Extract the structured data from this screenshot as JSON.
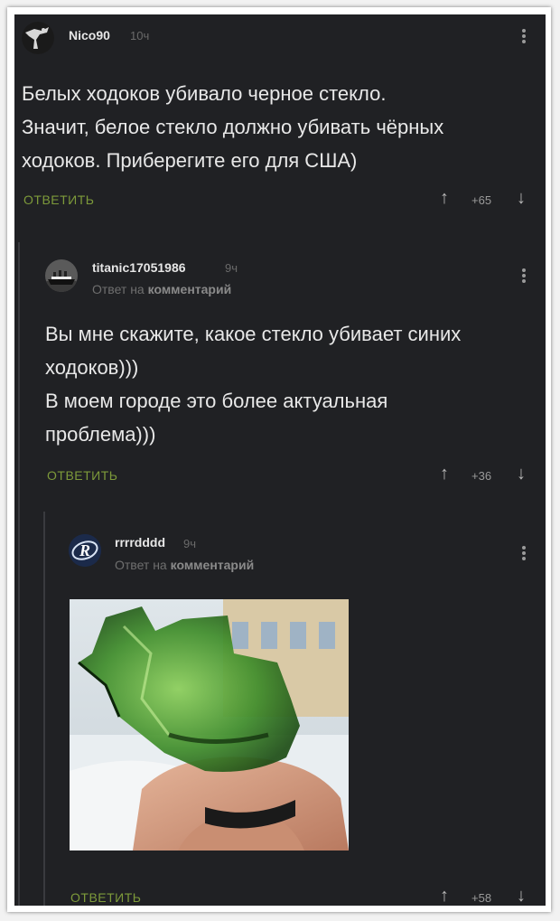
{
  "comments": [
    {
      "username": "Nico90",
      "time": "10ч",
      "lines": [
        "Белых ходоков убивало черное стекло.",
        "Значит, белое стекло должно убивать чёрных",
        "ходоков. Приберегите его для США)"
      ],
      "reply_label": "ответить",
      "score": "+65",
      "avatar_icon": "tree-silhouette-icon"
    },
    {
      "username": "titanic17051986",
      "time": "9ч",
      "reply_to_prefix": "Ответ на",
      "reply_to_target": "комментарий",
      "lines": [
        "Вы мне скажите, какое стекло убивает синих",
        "ходоков)))",
        "В моем городе это более актуальная",
        "проблема)))"
      ],
      "reply_label": "ответить",
      "score": "+36",
      "avatar_icon": "titanic-ship-icon"
    },
    {
      "username": "rrrrdddd",
      "time": "9ч",
      "reply_to_prefix": "Ответ на",
      "reply_to_target": "комментарий",
      "reply_label": "ответить",
      "score": "+58",
      "avatar_icon": "r-logo-icon",
      "image_subject": "broken-green-glass-bottle-photo"
    }
  ],
  "icons": {
    "upvote": "↑",
    "downvote": "↓",
    "more": "more-vertical-icon"
  },
  "colors": {
    "background": "#202124",
    "text": "#e8e8e8",
    "reply_link": "#7d9a3a",
    "muted": "#6f6f6f"
  }
}
